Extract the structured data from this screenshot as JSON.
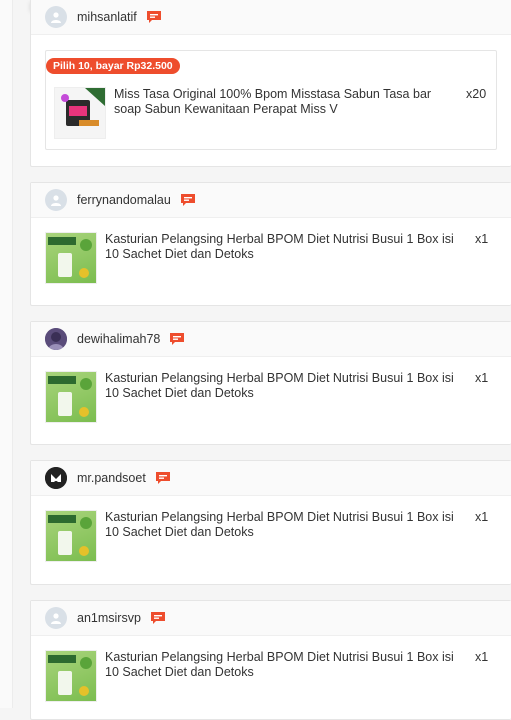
{
  "orders": [
    {
      "username": "mihsanlatif",
      "promo_label": "Pilih 10, bayar Rp32.500",
      "product_name": "Miss Tasa Original 100% Bpom Misstasa Sabun Tasa bar soap Sabun Kewanitaan Perapat Miss V",
      "quantity": "x20",
      "avatar": "default-avatar-icon"
    },
    {
      "username": "ferrynandomalau",
      "product_name": "Kasturian Pelangsing Herbal BPOM Diet Nutrisi Busui 1 Box isi 10 Sachet Diet dan Detoks",
      "quantity": "x1",
      "avatar": "default-avatar-icon"
    },
    {
      "username": "dewihalimah78",
      "product_name": "Kasturian Pelangsing Herbal BPOM Diet Nutrisi Busui 1 Box isi 10 Sachet Diet dan Detoks",
      "quantity": "x1",
      "avatar": "photo-avatar"
    },
    {
      "username": "mr.pandsoet",
      "product_name": "Kasturian Pelangsing Herbal BPOM Diet Nutrisi Busui 1 Box isi 10 Sachet Diet dan Detoks",
      "quantity": "x1",
      "avatar": "photo-avatar"
    },
    {
      "username": "an1msirsvp",
      "product_name": "Kasturian Pelangsing Herbal BPOM Diet Nutrisi Busui 1 Box isi 10 Sachet Diet dan Detoks",
      "quantity": "x1",
      "avatar": "default-avatar-icon"
    }
  ],
  "colors": {
    "accent": "#ee4d2d",
    "header_bg": "#fafafa"
  }
}
